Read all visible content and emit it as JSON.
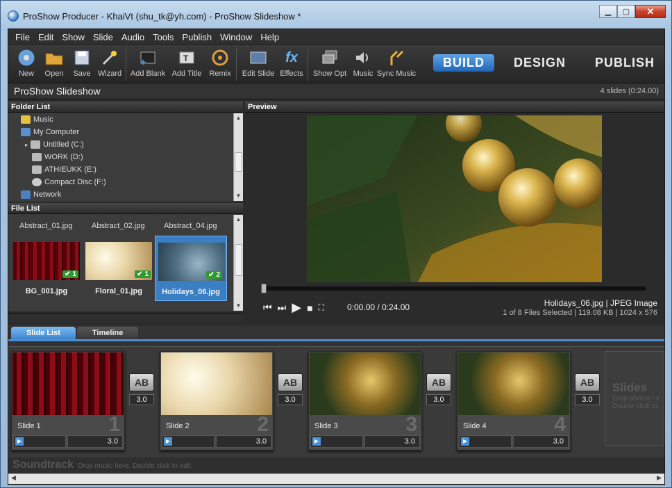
{
  "window": {
    "title": "ProShow Producer - KhaiVt (shu_tk@yh.com) - ProShow Slideshow *"
  },
  "menu": [
    "File",
    "Edit",
    "Show",
    "Slide",
    "Audio",
    "Tools",
    "Publish",
    "Window",
    "Help"
  ],
  "toolbar": {
    "new": "New",
    "open": "Open",
    "save": "Save",
    "wizard": "Wizard",
    "add_blank": "Add Blank",
    "add_title": "Add Title",
    "remix": "Remix",
    "edit_slide": "Edit Slide",
    "effects": "Effects",
    "show_opt": "Show Opt",
    "music": "Music",
    "sync_music": "Sync Music"
  },
  "modes": {
    "build": "BUILD",
    "design": "DESIGN",
    "publish": "PUBLISH"
  },
  "project": {
    "title": "ProShow Slideshow",
    "info": "4 slides (0:24.00)"
  },
  "folder_list": {
    "header": "Folder List",
    "items": [
      "Music",
      "My Computer",
      "Untitled (C:)",
      "WORK (D:)",
      "ATHIEUKK (E:)",
      "Compact Disc (F:)",
      "Network"
    ]
  },
  "file_list": {
    "header": "File List",
    "top_names": [
      "Abstract_01.jpg",
      "Abstract_02.jpg",
      "Abstract_04.jpg"
    ],
    "thumbs": [
      {
        "name": "BG_001.jpg",
        "badge": "1"
      },
      {
        "name": "Floral_01.jpg",
        "badge": "1"
      },
      {
        "name": "Holidays_06.jpg",
        "badge": "2"
      }
    ]
  },
  "preview": {
    "header": "Preview",
    "time": "0:00.00 / 0:24.00",
    "file": "Holidays_06.jpg  |  JPEG Image",
    "meta": "1 of 8 Files Selected |  119.08 KB  |  1024 x 576"
  },
  "tabs": {
    "slide_list": "Slide List",
    "timeline": "Timeline"
  },
  "slides": [
    {
      "label": "Slide 1",
      "num": "1",
      "dur": "3.0",
      "trans": "3.0"
    },
    {
      "label": "Slide 2",
      "num": "2",
      "dur": "3.0",
      "trans": "3.0"
    },
    {
      "label": "Slide 3",
      "num": "3",
      "dur": "3.0",
      "trans": "3.0"
    },
    {
      "label": "Slide 4",
      "num": "4",
      "dur": "3.0",
      "trans": "3.0"
    }
  ],
  "transition_icon": "AB",
  "empty_slot": {
    "title": "Slides",
    "line1": "Drop photos / v",
    "line2": "Double click to"
  },
  "soundtrack": {
    "title": "Soundtrack",
    "hint": "Drop music here.  Double click to edit."
  }
}
